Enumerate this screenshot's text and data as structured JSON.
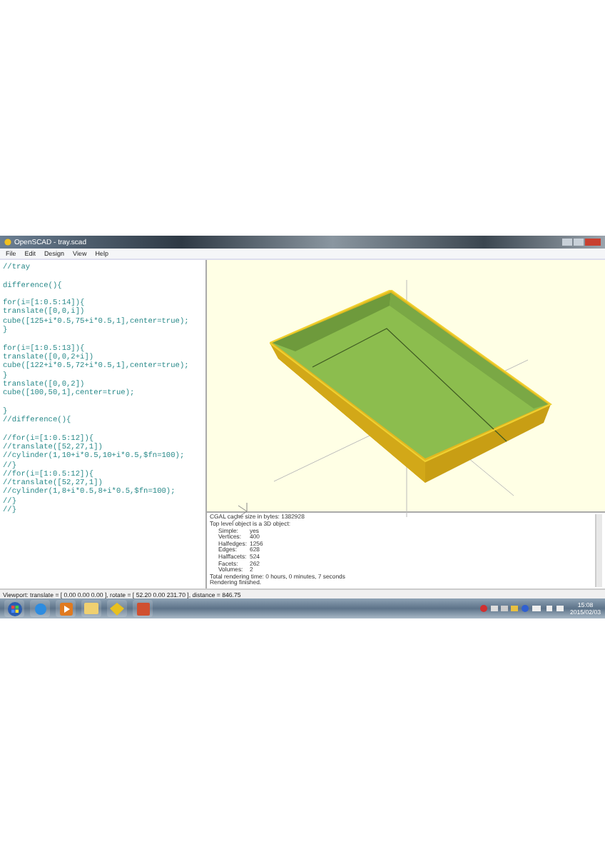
{
  "window": {
    "title": "OpenSCAD - tray.scad"
  },
  "menu": [
    "File",
    "Edit",
    "Design",
    "View",
    "Help"
  ],
  "editor": {
    "blocks": [
      [
        "//tray"
      ],
      [
        "difference(){"
      ],
      [
        "for(i=[1:0.5:14]){",
        "translate([0,0,i])",
        "cube([125+i*0.5,75+i*0.5,1],center=true);",
        "}"
      ],
      [
        "for(i=[1:0.5:13]){",
        "translate([0,0,2+i])",
        "cube([122+i*0.5,72+i*0.5,1],center=true);",
        "}",
        "translate([0,0,2])",
        "cube([100,50,1],center=true);"
      ],
      [
        "}",
        "//difference(){"
      ],
      [
        "//for(i=[1:0.5:12]){",
        "//translate([52,27,1])",
        "//cylinder(1,10+i*0.5,10+i*0.5,$fn=100);",
        "//}",
        "//for(i=[1:0.5:12]){",
        "//translate([52,27,1])",
        "//cylinder(1,8+i*0.5,8+i*0.5,$fn=100);",
        "//}",
        "//}"
      ]
    ]
  },
  "console": [
    {
      "kind": "line",
      "text": "CGAL cache size in bytes: 1382928"
    },
    {
      "kind": "line",
      "text": "Top level object is a 3D object:"
    },
    {
      "kind": "pair",
      "label": "Simple:",
      "value": "yes"
    },
    {
      "kind": "pair",
      "label": "Vertices:",
      "value": "400"
    },
    {
      "kind": "pair",
      "label": "Halfedges:",
      "value": "1256"
    },
    {
      "kind": "pair",
      "label": "Edges:",
      "value": "628"
    },
    {
      "kind": "pair",
      "label": "Halffacets:",
      "value": "524"
    },
    {
      "kind": "pair",
      "label": "Facets:",
      "value": "262"
    },
    {
      "kind": "pair",
      "label": "Volumes:",
      "value": "2"
    },
    {
      "kind": "line",
      "text": "Total rendering time: 0 hours, 0 minutes, 7 seconds"
    },
    {
      "kind": "line",
      "text": "Rendering finished."
    }
  ],
  "status_bar": "Viewport: translate = [ 0.00 0.00 0.00 ], rotate = [ 52.20 0.00 231.70 ], distance = 846.75",
  "taskbar": {
    "clock_time": "15:08",
    "clock_date": "2015/02/03"
  }
}
